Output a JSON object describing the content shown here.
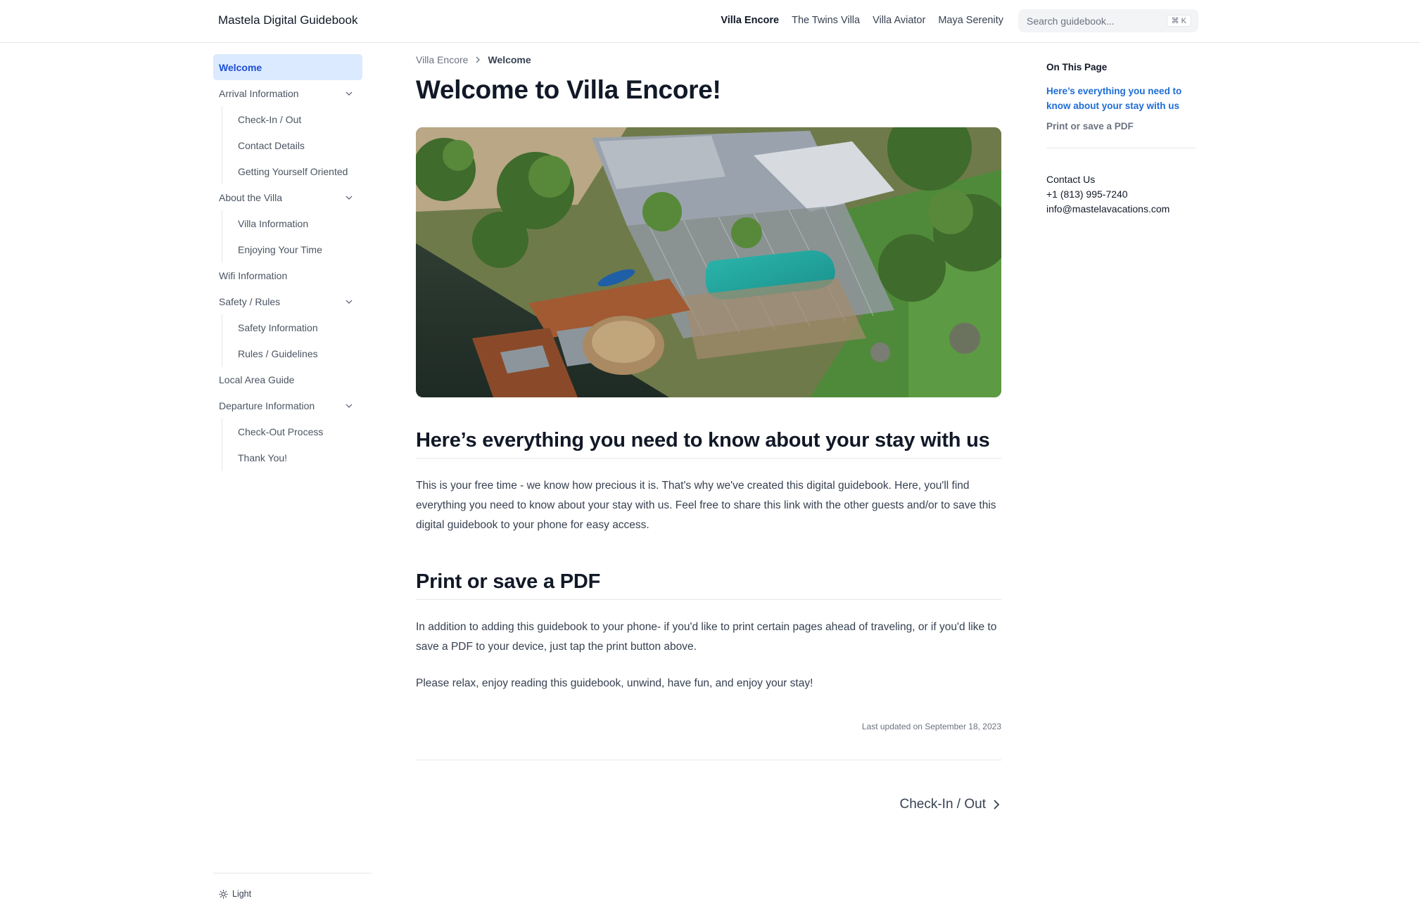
{
  "header": {
    "brand": "Mastela Digital Guidebook",
    "nav": [
      "Villa Encore",
      "The Twins Villa",
      "Villa Aviator",
      "Maya Serenity"
    ],
    "active_nav": "Villa Encore",
    "search_placeholder": "Search guidebook...",
    "search_shortcut": "⌘ K"
  },
  "sidebar": {
    "welcome": "Welcome",
    "arrival": "Arrival Information",
    "arrival_items": [
      "Check-In / Out",
      "Contact Details",
      "Getting Yourself Oriented"
    ],
    "about": "About the Villa",
    "about_items": [
      "Villa Information",
      "Enjoying Your Time"
    ],
    "wifi": "Wifi Information",
    "safety": "Safety / Rules",
    "safety_items": [
      "Safety Information",
      "Rules / Guidelines"
    ],
    "local": "Local Area Guide",
    "departure": "Departure Information",
    "departure_items": [
      "Check-Out Process",
      "Thank You!"
    ],
    "theme_label": "Light"
  },
  "breadcrumb": {
    "parent": "Villa Encore",
    "current": "Welcome"
  },
  "main": {
    "title": "Welcome to Villa Encore!",
    "section1_heading": "Here’s everything you need to know about your stay with us",
    "section1_text": "This is your free time - we know how precious it is. That's why we've created this digital guidebook. Here, you'll find everything you need to know about your stay with us. Feel free to share this link with the other guests and/or to save this digital guidebook to your phone for easy access.",
    "section2_heading": "Print or save a PDF",
    "section2_text": "In addition to adding this guidebook to your phone- if you'd like to print certain pages ahead of traveling, or if you'd like to save a PDF to your device, just tap the print button above.",
    "closing_text": "Please relax, enjoy reading this guidebook, unwind, have fun, and enjoy your stay!",
    "last_updated": "Last updated on September 18, 2023",
    "next_label": "Check-In / Out"
  },
  "toc": {
    "title": "On This Page",
    "links": [
      "Here’s everything you need to know about your stay with us",
      "Print or save a PDF"
    ],
    "contact_title": "Contact Us",
    "phone": "+1 (813) 995-7240",
    "email": "info@mastelavacations.com"
  },
  "colors": {
    "accent": "#1d6dd6",
    "active_bg": "#dbeafe",
    "border": "#e5e7eb"
  }
}
